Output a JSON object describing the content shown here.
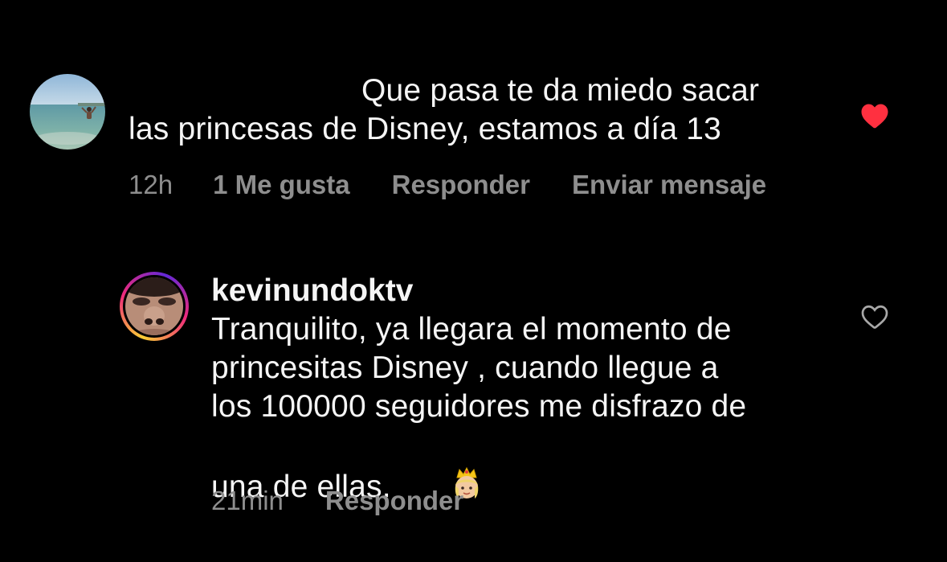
{
  "comments": [
    {
      "text_line1": "Que pasa te da miedo sacar",
      "text_line2": "las princesas de Disney, estamos a día 13",
      "time": "12h",
      "likes": "1 Me gusta",
      "reply": "Responder",
      "send": "Enviar mensaje",
      "liked": true,
      "heart_color": "#ff3040"
    },
    {
      "username": "kevinundoktv",
      "text_line1": "Tranquilito, ya llegara el momento de",
      "text_line2": "princesitas Disney , cuando llegue a",
      "text_line3": "los 100000 seguidores me disfrazo de",
      "text_line4": "una de ellas.",
      "emoji": "princess-emoji",
      "time": "21min",
      "reply": "Responder",
      "liked": false
    }
  ],
  "colors": {
    "background": "#000000",
    "text": "#f5f5f5",
    "meta": "#8e8e8e",
    "like": "#ff3040"
  }
}
